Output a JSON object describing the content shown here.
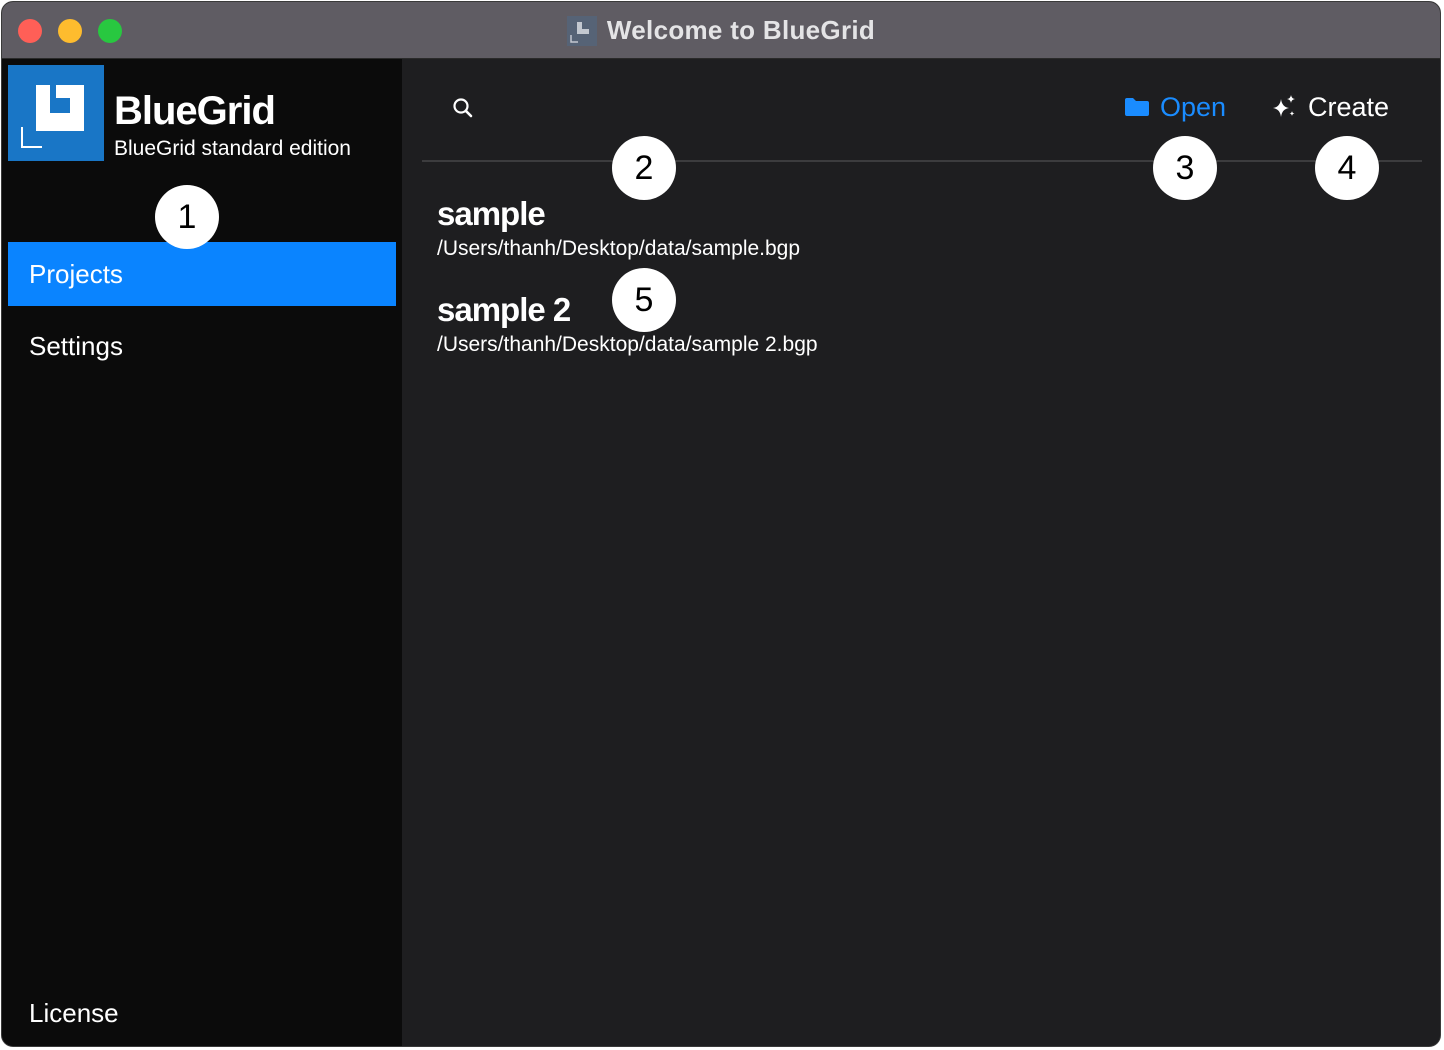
{
  "window": {
    "title": "Welcome to BlueGrid"
  },
  "sidebar": {
    "brand_name": "BlueGrid",
    "brand_subtitle": "BlueGrid standard edition",
    "items": [
      {
        "label": "Projects",
        "selected": true
      },
      {
        "label": "Settings",
        "selected": false
      }
    ],
    "footer_label": "License"
  },
  "toolbar": {
    "search_icon": "search-icon",
    "open_label": "Open",
    "open_icon": "folder-icon",
    "create_label": "Create",
    "create_icon": "sparkles-icon"
  },
  "projects": [
    {
      "name": "sample",
      "path": "/Users/thanh/Desktop/data/sample.bgp"
    },
    {
      "name": "sample 2",
      "path": "/Users/thanh/Desktop/data/sample 2.bgp"
    }
  ],
  "callouts": [
    "1",
    "2",
    "3",
    "4",
    "5"
  ],
  "colors": {
    "accent": "#0a84ff",
    "open_text": "#1a8cff",
    "logo_bg": "#1976c6",
    "sidebar_bg": "#0b0b0b",
    "main_bg": "#1e1e20",
    "titlebar_bg": "#5f5c63"
  }
}
